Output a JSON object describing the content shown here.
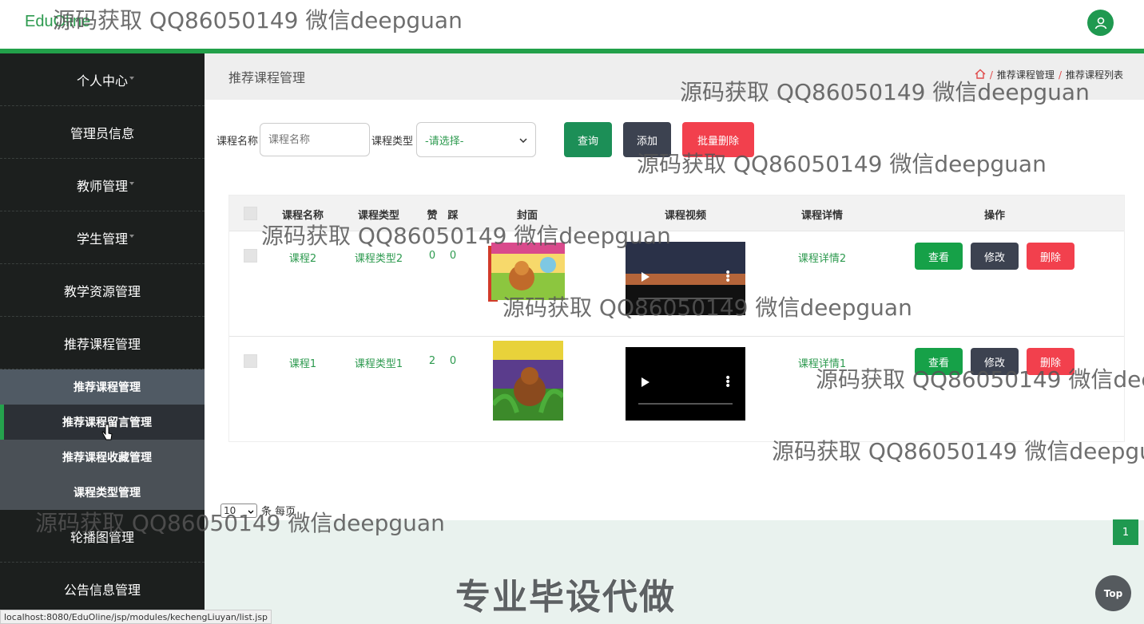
{
  "header": {
    "logo": "EduOline"
  },
  "sidebar": {
    "items": [
      {
        "label": "个人中心"
      },
      {
        "label": "管理员信息"
      },
      {
        "label": "教师管理"
      },
      {
        "label": "学生管理"
      },
      {
        "label": "教学资源管理"
      },
      {
        "label": "推荐课程管理"
      }
    ],
    "subitems": [
      {
        "label": "推荐课程管理"
      },
      {
        "label": "推荐课程留言管理"
      },
      {
        "label": "推荐课程收藏管理"
      },
      {
        "label": "课程类型管理"
      }
    ],
    "items_after": [
      {
        "label": "轮播图管理"
      },
      {
        "label": "公告信息管理"
      }
    ]
  },
  "page": {
    "title": "推荐课程管理",
    "breadcrumb": [
      "推荐课程管理",
      "推荐课程列表"
    ]
  },
  "search": {
    "name_label": "课程名称",
    "name_placeholder": "课程名称",
    "type_label": "课程类型",
    "type_selected": "-请选择-",
    "query_label": "查询",
    "add_label": "添加",
    "batch_delete_label": "批量删除"
  },
  "table": {
    "columns": [
      "课程名称",
      "课程类型",
      "赞",
      "踩",
      "封面",
      "课程视频",
      "课程详情",
      "操作"
    ],
    "rows": [
      {
        "name": "课程2",
        "type": "课程类型2",
        "likes": "0",
        "dislikes": "0",
        "detail": "课程详情2"
      },
      {
        "name": "课程1",
        "type": "课程类型1",
        "likes": "2",
        "dislikes": "0",
        "detail": "课程详情1"
      }
    ],
    "actions": {
      "view": "查看",
      "edit": "修改",
      "delete": "删除"
    }
  },
  "pagination": {
    "page_size": "10",
    "per_page_text": "条 每页",
    "current_page": "1"
  },
  "watermark": "源码获取 QQ86050149 微信deepguan",
  "promo": "专业毕设代做",
  "top_button": "Top",
  "status_url": "localhost:8080/EduOline/jsp/modules/kechengLiuyan/list.jsp",
  "colors": {
    "accent": "#22a04a",
    "sidebar_bg": "#1c1f1e",
    "danger": "#f2404d",
    "dark_button": "#3c4250"
  }
}
